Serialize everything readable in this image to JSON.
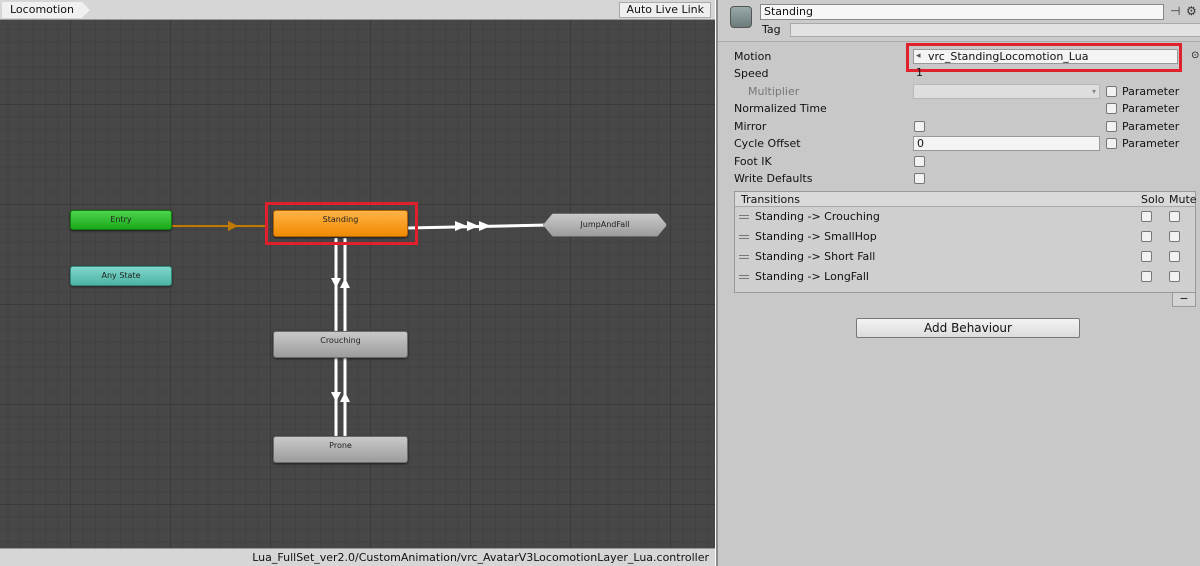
{
  "animator": {
    "breadcrumb": "Locomotion",
    "auto_live_link": "Auto Live Link",
    "footer_path": "Lua_FullSet_ver2.0/CustomAnimation/vrc_AvatarV3LocomotionLayer_Lua.controller",
    "nodes": {
      "entry": "Entry",
      "any_state": "Any State",
      "standing": "Standing",
      "jump_and_fall": "JumpAndFall",
      "crouching": "Crouching",
      "prone": "Prone"
    }
  },
  "inspector": {
    "state_name": "Standing",
    "tag_label": "Tag",
    "tag_value": "",
    "motion_label": "Motion",
    "motion_value": "vrc_StandingLocomotion_Lua",
    "speed_label": "Speed",
    "speed_value": "1",
    "multiplier_label": "Multiplier",
    "normalized_time_label": "Normalized Time",
    "mirror_label": "Mirror",
    "cycle_offset_label": "Cycle Offset",
    "cycle_offset_value": "0",
    "foot_ik_label": "Foot IK",
    "write_defaults_label": "Write Defaults",
    "parameter_label": "Parameter",
    "transitions": {
      "header": "Transitions",
      "solo": "Solo",
      "mute": "Mute",
      "rows": [
        "Standing -> Crouching",
        "Standing -> SmallHop",
        "Standing -> Short Fall",
        "Standing -> LongFall"
      ],
      "remove": "−"
    },
    "add_behaviour": "Add Behaviour"
  },
  "colors": {
    "highlight": "#e0202a",
    "standing_node": "#f08a00",
    "entry_node": "#1aa81a",
    "any_state_node": "#4cb3a4"
  }
}
